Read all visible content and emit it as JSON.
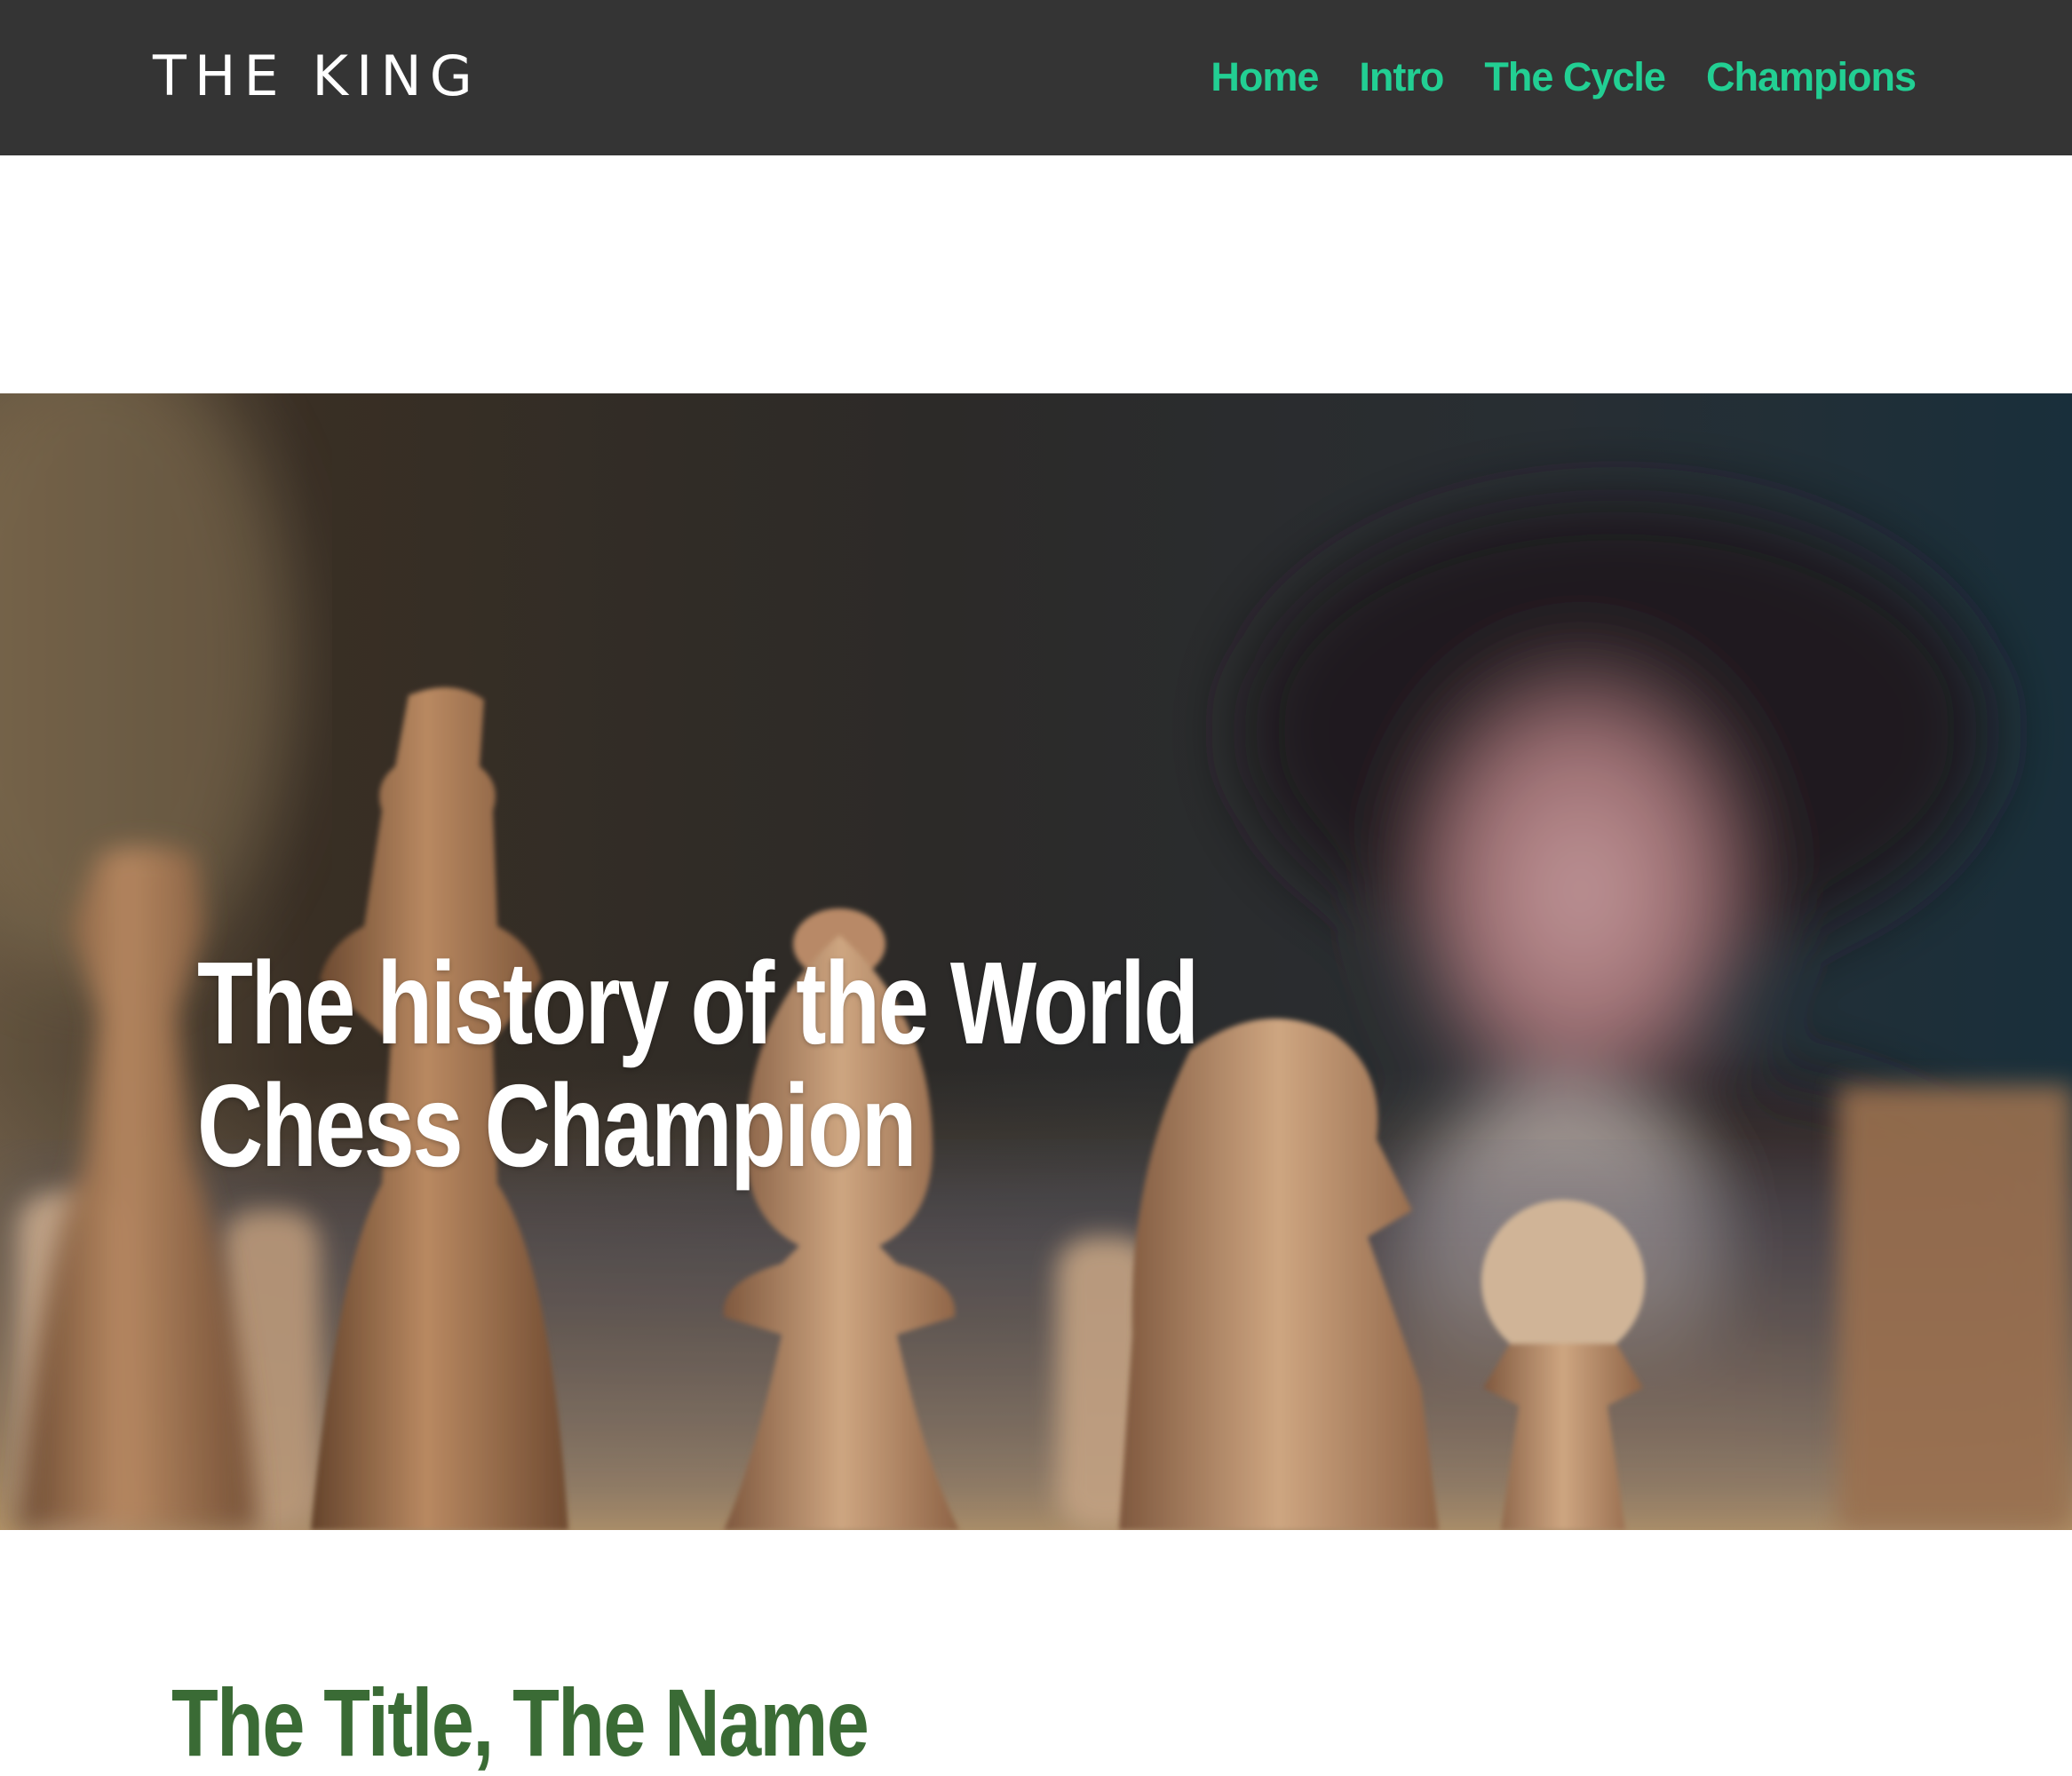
{
  "header": {
    "brand": "THE KING",
    "nav": [
      {
        "label": "Home"
      },
      {
        "label": "Intro"
      },
      {
        "label": "The Cycle"
      },
      {
        "label": "Champions"
      }
    ]
  },
  "hero": {
    "title": "The history of the World Chess Champion",
    "image": "chess-pieces-photo"
  },
  "section": {
    "heading": "The Title, The Name"
  },
  "colors": {
    "navbar": "#343434",
    "nav_link": "#22cf93",
    "heading": "#3a6b35"
  }
}
